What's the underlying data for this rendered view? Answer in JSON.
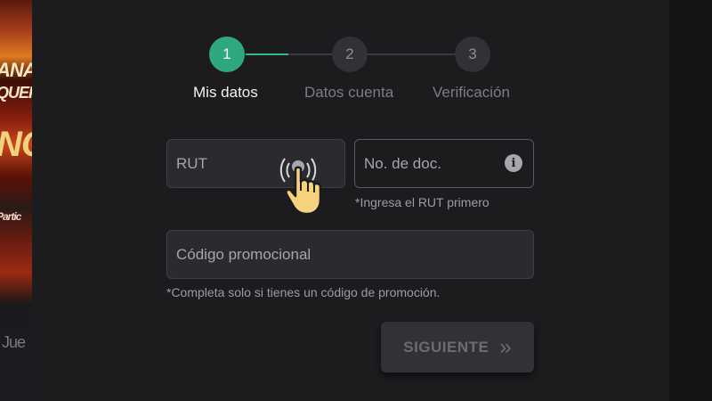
{
  "background": {
    "promo_lines": [
      "ANA",
      "QUEI",
      "NO",
      "Partic",
      "Jue"
    ]
  },
  "stepper": {
    "steps": [
      {
        "number": "1",
        "label": "Mis datos",
        "state": "active"
      },
      {
        "number": "2",
        "label": "Datos cuenta",
        "state": "inactive"
      },
      {
        "number": "3",
        "label": "Verificación",
        "state": "inactive"
      }
    ],
    "active_color": "#2fa87f"
  },
  "form": {
    "rut": {
      "placeholder": "RUT",
      "value": ""
    },
    "doc_number": {
      "placeholder": "No. de doc.",
      "value": "",
      "hint": "*Ingresa el RUT primero",
      "icon": "info-icon"
    },
    "promo_code": {
      "placeholder": "Código promocional",
      "value": "",
      "hint": "*Completa solo si tienes un código de promoción."
    }
  },
  "actions": {
    "next_label": "SIGUIENTE",
    "next_icon": "double-chevron-right-icon"
  },
  "cursor": {
    "icon": "tap-hand-cursor-icon"
  }
}
